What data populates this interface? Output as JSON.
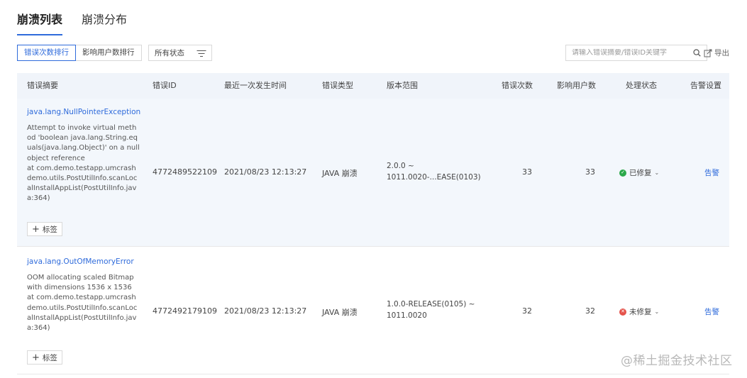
{
  "tabs": [
    {
      "label": "崩溃列表",
      "active": true
    },
    {
      "label": "崩溃分布",
      "active": false
    }
  ],
  "toolbar": {
    "sort_options": [
      {
        "label": "错误次数排行",
        "active": true
      },
      {
        "label": "影响用户数排行",
        "active": false
      }
    ],
    "status_filter_label": "所有状态",
    "search_placeholder": "请输入错误摘要/错误ID关键字",
    "export_label": "导出"
  },
  "columns": [
    "错误摘要",
    "错误ID",
    "最近一次发生时间",
    "错误类型",
    "版本范围",
    "错误次数",
    "影响用户数",
    "处理状态",
    "告警设置"
  ],
  "rows": [
    {
      "name": "java.lang.NullPointerException",
      "message": "Attempt to invoke virtual meth\nod 'boolean java.lang.String.eq\nuals(java.lang.Object)' on a null\nobject reference\nat com.demo.testapp.umcrash\ndemo.utils.PostUtilInfo.scanLoc\nalInstallAppList(PostUtilInfo.jav\na:364)",
      "tag_label": "标签",
      "error_id": "4772489522109",
      "last_time": "2021/08/23 12:13:27",
      "type": "JAVA 崩溃",
      "version": "2.0.0 ~\n1011.0020-...EASE(0103)",
      "error_count": "33",
      "users": "33",
      "status": "已修复",
      "status_color": "#2aa84a",
      "alarm": "告警"
    },
    {
      "name": "java.lang.OutOfMemoryError",
      "message": "OOM allocating scaled Bitmap\nwith dimensions 1536 x 1536\nat com.demo.testapp.umcrash\ndemo.utils.PostUtilInfo.scanLoc\nalInstallAppList(PostUtilInfo.jav\na:364)",
      "tag_label": "标签",
      "error_id": "4772492179109",
      "last_time": "2021/08/23 12:13:27",
      "type": "JAVA 崩溃",
      "version": "1.0.0-RELEASE(0105) ~\n1011.0020",
      "error_count": "32",
      "users": "32",
      "status": "未修复",
      "status_color": "#e5534b",
      "alarm": "告警"
    }
  ],
  "watermark": "@稀土掘金技术社区"
}
